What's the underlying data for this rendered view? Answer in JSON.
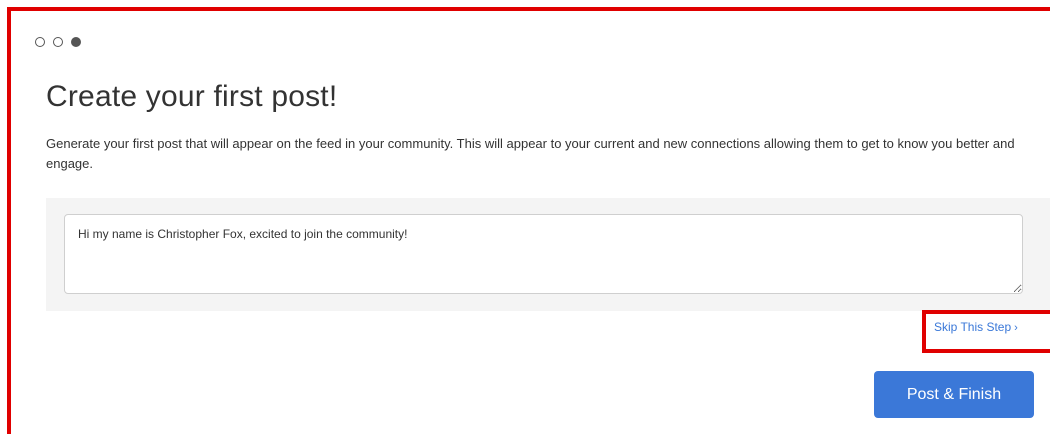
{
  "steps": {
    "total": 3,
    "current": 3
  },
  "header": {
    "title": "Create your first post!"
  },
  "main": {
    "description": "Generate your first post that will appear on the feed in your community. This will appear to your current and new connections allowing them to get to know you better and engage.",
    "post_input": {
      "value": "Hi my name is Christopher Fox, excited to join the community!"
    },
    "skip_label": "Skip This Step",
    "skip_chevron": "›",
    "submit_label": "Post & Finish"
  },
  "colors": {
    "accent": "#3b78d8",
    "link": "#3a78d8",
    "annotation": "#e00000",
    "panel_background": "#f4f4f4"
  },
  "icons": {
    "step_completed": "hollow-circle-icon",
    "step_current": "filled-circle-icon",
    "skip": "chevron-right-icon"
  }
}
